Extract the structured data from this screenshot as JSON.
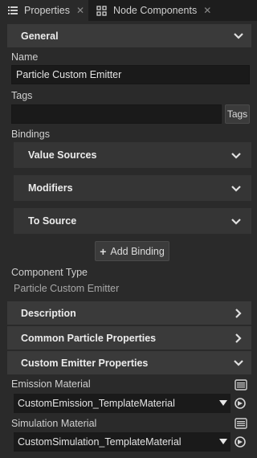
{
  "tabs": [
    {
      "label": "Properties",
      "icon": "list-icon",
      "active": true
    },
    {
      "label": "Node Components",
      "icon": "components-icon",
      "active": false
    }
  ],
  "general": {
    "title": "General",
    "name_label": "Name",
    "name_value": "Particle Custom Emitter",
    "tags_label": "Tags",
    "tags_value": "",
    "tags_button": "Tags",
    "bindings_label": "Bindings",
    "value_sources": "Value Sources",
    "modifiers": "Modifiers",
    "to_source": "To Source",
    "add_binding": "Add Binding",
    "component_type_label": "Component Type",
    "component_type_value": "Particle Custom Emitter"
  },
  "sections": {
    "description": "Description",
    "common_particle": "Common Particle Properties",
    "custom_emitter": "Custom Emitter Properties"
  },
  "custom_emitter": {
    "emission_label": "Emission Material",
    "emission_value": "CustomEmission_TemplateMaterial",
    "simulation_label": "Simulation Material",
    "simulation_value": "CustomSimulation_TemplateMaterial"
  },
  "colors": {
    "background": "#2a2a2a",
    "header": "#3a3a3a",
    "field": "#1a1a1a",
    "tabbar": "#1d1d1d"
  }
}
